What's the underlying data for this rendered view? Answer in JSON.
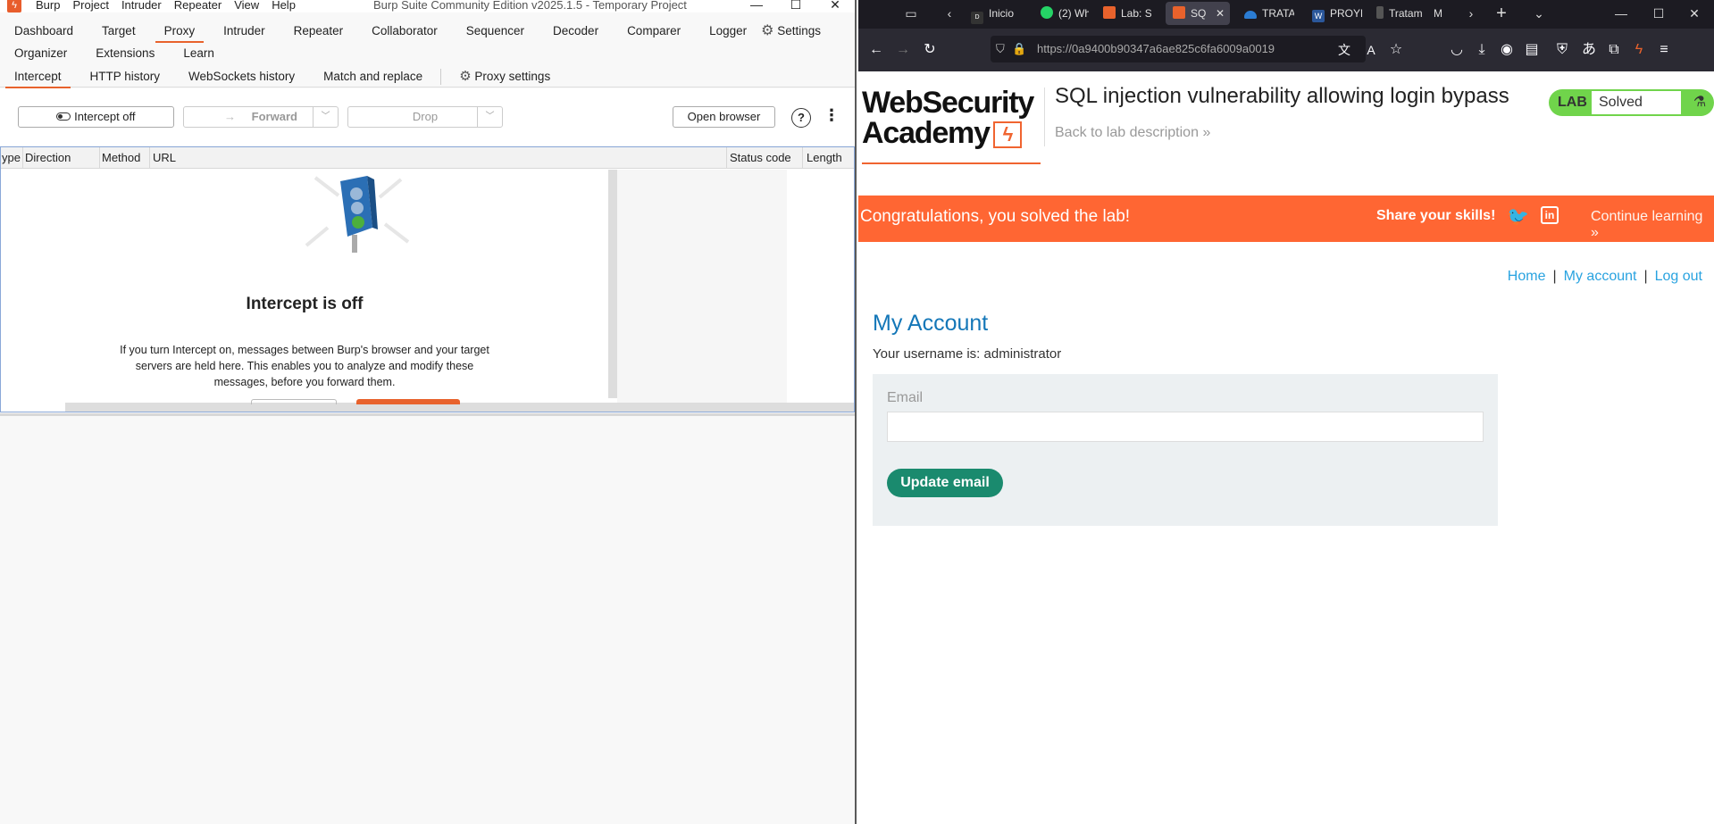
{
  "burp": {
    "menu": [
      "Burp",
      "Project",
      "Intruder",
      "Repeater",
      "View",
      "Help"
    ],
    "window_title": "Burp Suite Community Edition v2025.1.5 - Temporary Project",
    "window_controls": [
      "—",
      "☐",
      "✕"
    ],
    "tabs_row1": [
      "Dashboard",
      "Target",
      "Proxy",
      "Intruder",
      "Repeater",
      "Collaborator",
      "Sequencer",
      "Decoder",
      "Comparer",
      "Logger"
    ],
    "settings_label": "Settings",
    "tabs_row2": [
      "Organizer",
      "Extensions",
      "Learn"
    ],
    "proxy_tabs": [
      "Intercept",
      "HTTP history",
      "WebSockets history",
      "Match and replace"
    ],
    "proxy_settings_label": "Proxy settings",
    "toolbar": {
      "intercept_label": "Intercept off",
      "forward_label": "Forward",
      "drop_label": "Drop",
      "open_browser_label": "Open browser",
      "help_icon": "?",
      "more_icon": "⋮"
    },
    "table_headers": [
      "ype",
      "Direction",
      "Method",
      "URL",
      "Status code",
      "Length"
    ],
    "intercept_title": "Intercept is off",
    "intercept_desc": "If you turn Intercept on, messages between Burp's browser and your target servers are held here. This enables you to analyze and modify these messages, before you forward them."
  },
  "browser": {
    "tabs": [
      {
        "label": "Inicio",
        "icon_color": "#333333"
      },
      {
        "label": "(2) Wh",
        "icon_color": "#25d366"
      },
      {
        "label": "Lab: S",
        "icon_color": "#e8622c"
      },
      {
        "label": "SQ",
        "icon_color": "#e8622c",
        "active": true
      },
      {
        "label": "TRATA",
        "icon_color": "#2b7cd3"
      },
      {
        "label": "PROYE",
        "icon_color": "#2b579a"
      },
      {
        "label": "Tratam",
        "icon_color": "#555555"
      },
      {
        "label": "M",
        "icon_color": "#1c1b22"
      }
    ],
    "url": "https://0a9400b90347a6ae825c6fa6009a0019",
    "page": {
      "logo_line1": "WebSecurity",
      "logo_line2": "Academy",
      "lab_title": "SQL injection vulnerability allowing login bypass",
      "back_link": "Back to lab description",
      "badge_label": "LAB",
      "badge_status": "Solved",
      "congrats": "Congratulations, you solved the lab!",
      "share": "Share your skills!",
      "continue": "Continue learning",
      "nav": [
        "Home",
        "My account",
        "Log out"
      ],
      "heading": "My Account",
      "username_text": "Your username is: administrator",
      "email_label": "Email",
      "email_value": "",
      "update_button": "Update email"
    }
  },
  "colors": {
    "burp_accent": "#e8622c",
    "portswigger_orange": "#ff6633",
    "lab_solved_green": "#70d44b",
    "link_blue": "#29a3e0",
    "update_button": "#1a8a6e"
  }
}
